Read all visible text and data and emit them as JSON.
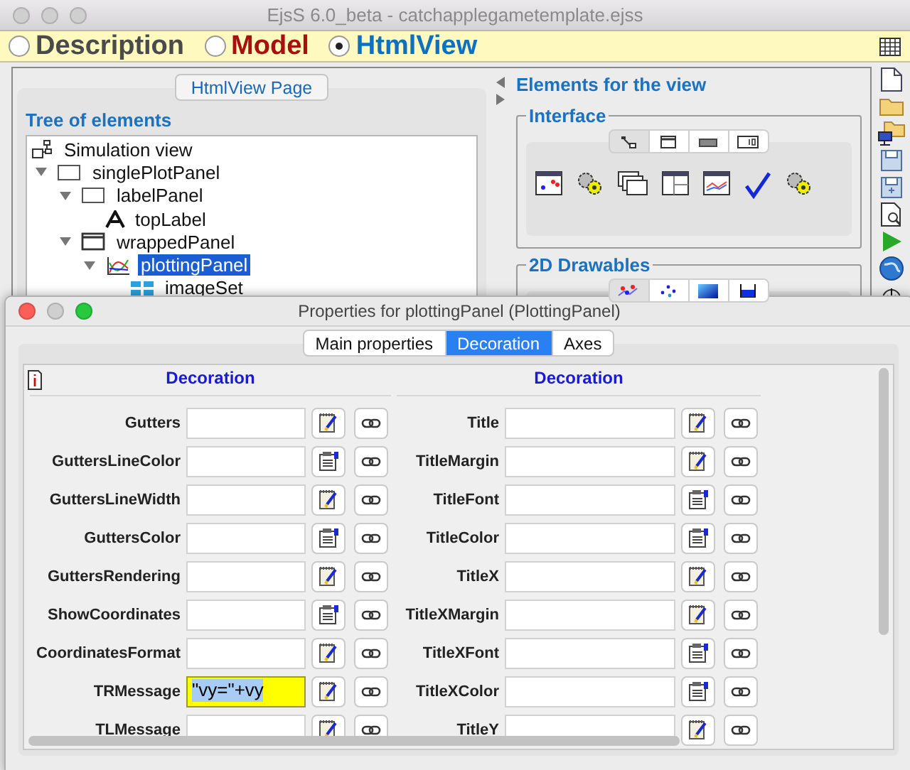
{
  "window": {
    "title": "EjsS 6.0_beta - catchapplegametemplate.ejss"
  },
  "modes": [
    {
      "label": "Description",
      "color": "#4a4a4a",
      "selected": false
    },
    {
      "label": "Model",
      "color": "#a81010",
      "selected": false
    },
    {
      "label": "HtmlView",
      "color": "#1070c0",
      "selected": true
    }
  ],
  "page_button": "HtmlView Page",
  "tree": {
    "title": "Tree of elements",
    "root": {
      "label": "Simulation view",
      "kind": "view",
      "children": [
        {
          "label": "singlePlotPanel",
          "kind": "panel",
          "expanded": true,
          "selected": false,
          "children": [
            {
              "label": "labelPanel",
              "kind": "panel",
              "expanded": true,
              "selected": false,
              "children": [
                {
                  "label": "topLabel",
                  "kind": "label",
                  "selected": false
                }
              ]
            },
            {
              "label": "wrappedPanel",
              "kind": "window",
              "expanded": true,
              "selected": false,
              "children": [
                {
                  "label": "plottingPanel",
                  "kind": "plot",
                  "expanded": true,
                  "selected": true,
                  "children": [
                    {
                      "label": "imageSet",
                      "kind": "images",
                      "selected": false
                    }
                  ]
                }
              ]
            }
          ]
        }
      ]
    }
  },
  "palette": {
    "title": "Elements for the view",
    "groups": [
      {
        "title": "Interface",
        "tabs": [
          {
            "kind": "tree",
            "selected": true
          },
          {
            "kind": "window",
            "selected": false
          },
          {
            "kind": "bar",
            "selected": false
          },
          {
            "kind": "number",
            "selected": false
          }
        ],
        "items": [
          {
            "kind": "plot"
          },
          {
            "kind": "gears"
          },
          {
            "kind": "windows"
          },
          {
            "kind": "panel"
          },
          {
            "kind": "chart"
          },
          {
            "kind": "check"
          },
          {
            "kind": "gears"
          }
        ]
      },
      {
        "title": "2D Drawables",
        "tabs": [
          {
            "kind": "points",
            "selected": true
          },
          {
            "kind": "dots",
            "selected": false
          },
          {
            "kind": "gradient",
            "selected": false
          },
          {
            "kind": "tank",
            "selected": false
          }
        ]
      }
    ]
  },
  "toolbar": [
    {
      "kind": "new"
    },
    {
      "kind": "open"
    },
    {
      "kind": "open-remote"
    },
    {
      "kind": "save"
    },
    {
      "kind": "save-as"
    },
    {
      "kind": "preview"
    },
    {
      "kind": "run"
    },
    {
      "kind": "globe"
    },
    {
      "kind": "download"
    }
  ],
  "dialog": {
    "title": "Properties for plottingPanel (PlottingPanel)",
    "tabs": [
      {
        "label": "Main properties",
        "selected": false
      },
      {
        "label": "Decoration",
        "selected": true
      },
      {
        "label": "Axes",
        "selected": false
      }
    ],
    "columns": [
      {
        "heading": "Decoration",
        "properties": [
          {
            "label": "Gutters",
            "kind": "edit",
            "highlighted": false
          },
          {
            "label": "GuttersLineColor",
            "kind": "choose",
            "highlighted": false
          },
          {
            "label": "GuttersLineWidth",
            "kind": "edit",
            "highlighted": false
          },
          {
            "label": "GuttersColor",
            "kind": "choose",
            "highlighted": false
          },
          {
            "label": "GuttersRendering",
            "kind": "edit",
            "highlighted": false
          },
          {
            "label": "ShowCoordinates",
            "kind": "choose",
            "highlighted": false
          },
          {
            "label": "CoordinatesFormat",
            "kind": "edit",
            "highlighted": false
          },
          {
            "label": "TRMessage",
            "value": "\"vy=\"+vy",
            "kind": "edit",
            "highlighted": true
          },
          {
            "label": "TLMessage",
            "kind": "edit",
            "highlighted": false
          }
        ]
      },
      {
        "heading": "Decoration",
        "properties": [
          {
            "label": "Title",
            "kind": "edit",
            "highlighted": false
          },
          {
            "label": "TitleMargin",
            "kind": "edit",
            "highlighted": false
          },
          {
            "label": "TitleFont",
            "kind": "choose",
            "highlighted": false
          },
          {
            "label": "TitleColor",
            "kind": "choose",
            "highlighted": false
          },
          {
            "label": "TitleX",
            "kind": "edit",
            "highlighted": false
          },
          {
            "label": "TitleXMargin",
            "kind": "edit",
            "highlighted": false
          },
          {
            "label": "TitleXFont",
            "kind": "choose",
            "highlighted": false
          },
          {
            "label": "TitleXColor",
            "kind": "choose",
            "highlighted": false
          },
          {
            "label": "TitleY",
            "kind": "edit",
            "highlighted": false
          }
        ]
      }
    ]
  }
}
